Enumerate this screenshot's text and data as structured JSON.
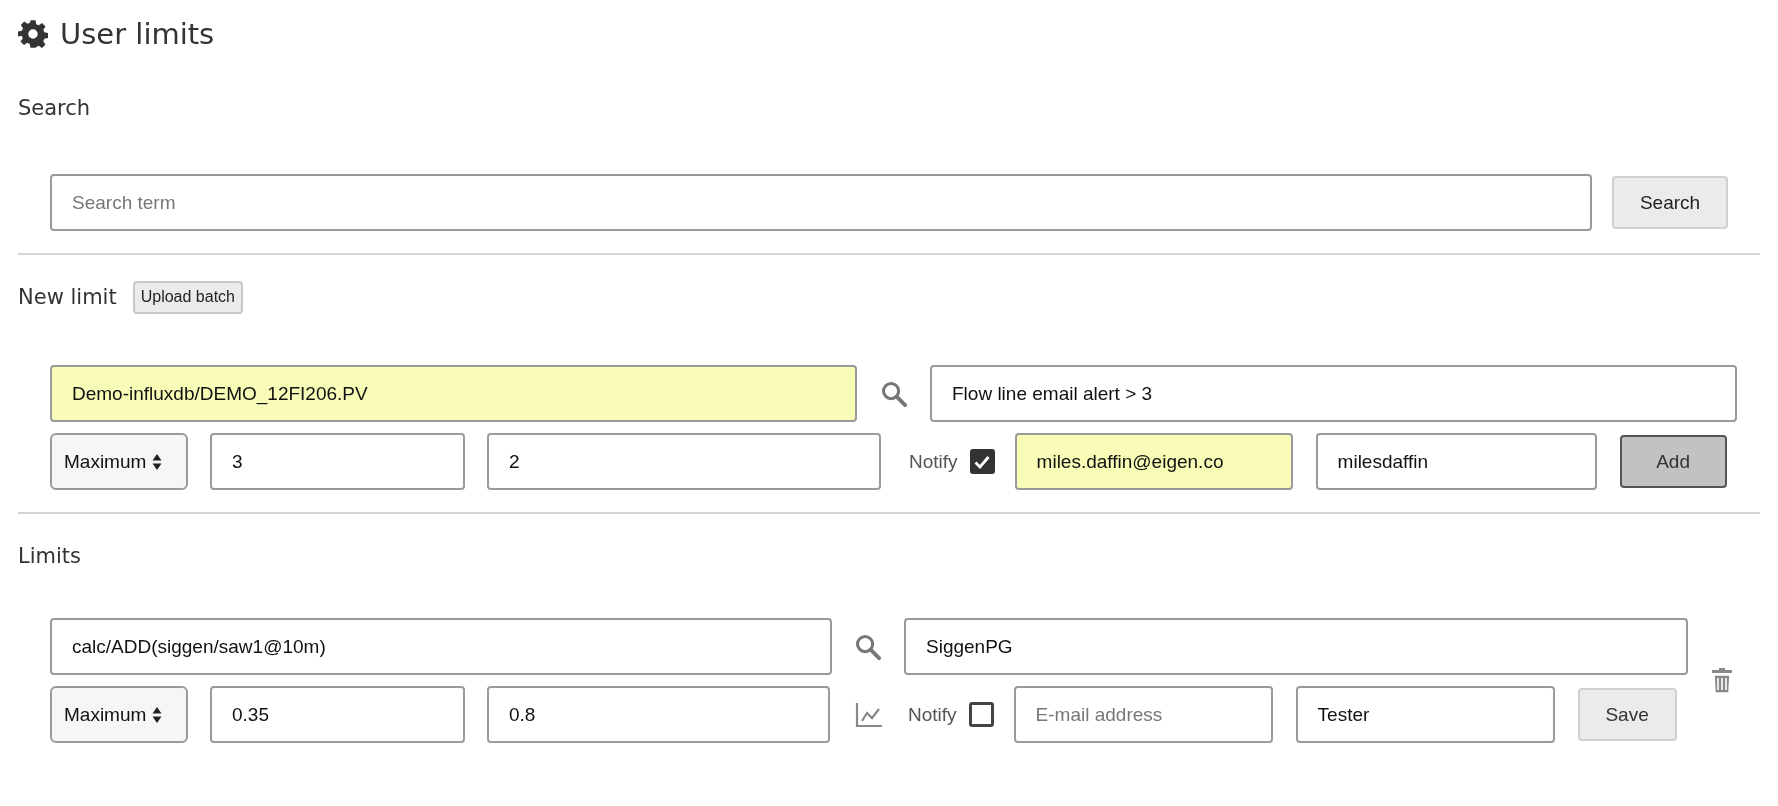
{
  "page": {
    "title": "User limits"
  },
  "search": {
    "heading": "Search",
    "placeholder": "Search term",
    "button": "Search"
  },
  "new_limit": {
    "heading": "New limit",
    "upload_button": "Upload batch",
    "form": {
      "tag": {
        "value": "Demo-influxdb/DEMO_12FI206.PV",
        "highlighted": true
      },
      "description": {
        "value": "Flow line email alert > 3",
        "highlighted": false
      },
      "type": "Maximum",
      "limit": "3",
      "reset": "2",
      "notify_label": "Notify",
      "notify": {
        "checked": true
      },
      "email": {
        "value": "miles.daffin@eigen.co",
        "highlighted": true
      },
      "user": {
        "value": "milesdaffin",
        "highlighted": false
      },
      "button": {
        "label": "Add",
        "kind": "primary"
      }
    }
  },
  "limits": {
    "heading": "Limits",
    "rows": [
      {
        "tag": {
          "value": "calc/ADD(siggen/saw1@10m)",
          "highlighted": false
        },
        "description": {
          "value": "SiggenPG",
          "highlighted": false
        },
        "type": "Maximum",
        "limit": "0.35",
        "reset": "0.8",
        "notify_label": "Notify",
        "notify": {
          "checked": false
        },
        "email": {
          "placeholder": "E-mail address",
          "highlighted": false
        },
        "user": {
          "value": "Tester",
          "highlighted": false
        },
        "button": {
          "label": "Save",
          "kind": "secondary"
        }
      }
    ]
  }
}
